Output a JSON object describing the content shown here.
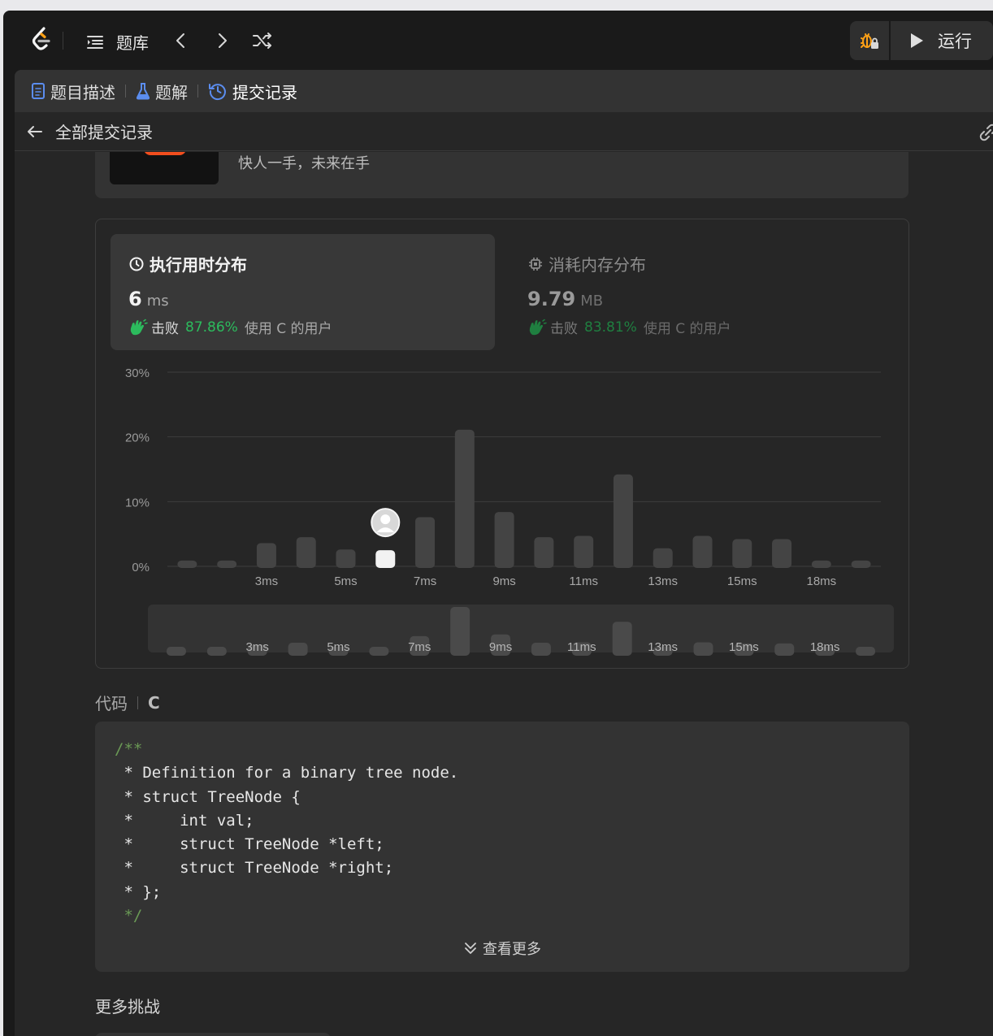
{
  "topbar": {
    "problem_list_label": "题库",
    "run_label": "运行"
  },
  "tabs": [
    {
      "label": "题目描述"
    },
    {
      "label": "题解"
    },
    {
      "label": "提交记录"
    }
  ],
  "subbar": {
    "back_label": "全部提交记录"
  },
  "promo": {
    "text": "快人一手，未来在手"
  },
  "runtime": {
    "title": "执行用时分布",
    "value": "6",
    "unit": "ms",
    "beat_prefix": "击败",
    "beat_pct": "87.86%",
    "beat_suffix": "使用 C 的用户"
  },
  "memory": {
    "title": "消耗内存分布",
    "value": "9.79",
    "unit": "MB",
    "beat_prefix": "击败",
    "beat_pct": "83.81%",
    "beat_suffix": "使用 C 的用户"
  },
  "chart_data": {
    "type": "bar",
    "x": [
      1,
      2,
      3,
      4,
      5,
      6,
      7,
      8,
      9,
      10,
      11,
      12,
      13,
      14,
      15,
      16,
      17,
      18
    ],
    "values": [
      0.9,
      0.9,
      3.6,
      4.5,
      2.6,
      2.5,
      7.6,
      21.1,
      8.4,
      4.5,
      4.7,
      14.2,
      2.8,
      4.7,
      4.2,
      4.2,
      0.9,
      0.9
    ],
    "highlight_index": 5,
    "tick_labels": [
      "",
      "",
      "3ms",
      "",
      "5ms",
      "",
      "7ms",
      "",
      "9ms",
      "",
      "11ms",
      "",
      "13ms",
      "",
      "15ms",
      "",
      "18ms",
      ""
    ],
    "y_ticks": [
      "0%",
      "10%",
      "20%",
      "30%"
    ],
    "ylim": [
      0,
      30
    ],
    "grid": true,
    "colors": {
      "bar": "#444444",
      "highlight": "#f2f2f2",
      "grid": "#3e3e3e"
    }
  },
  "code_section": {
    "label": "代码",
    "lang": "C",
    "lines": [
      {
        "text": "/**",
        "comment": true
      },
      {
        "text": " * Definition for a binary tree node.",
        "comment": false
      },
      {
        "text": " * struct TreeNode {",
        "comment": false
      },
      {
        "text": " *     int val;",
        "comment": false
      },
      {
        "text": " *     struct TreeNode *left;",
        "comment": false
      },
      {
        "text": " *     struct TreeNode *right;",
        "comment": false
      },
      {
        "text": " * };",
        "comment": false
      },
      {
        "text": " */",
        "comment": true
      }
    ],
    "more_label": "查看更多"
  },
  "more_challenges": {
    "title": "更多挑战"
  }
}
